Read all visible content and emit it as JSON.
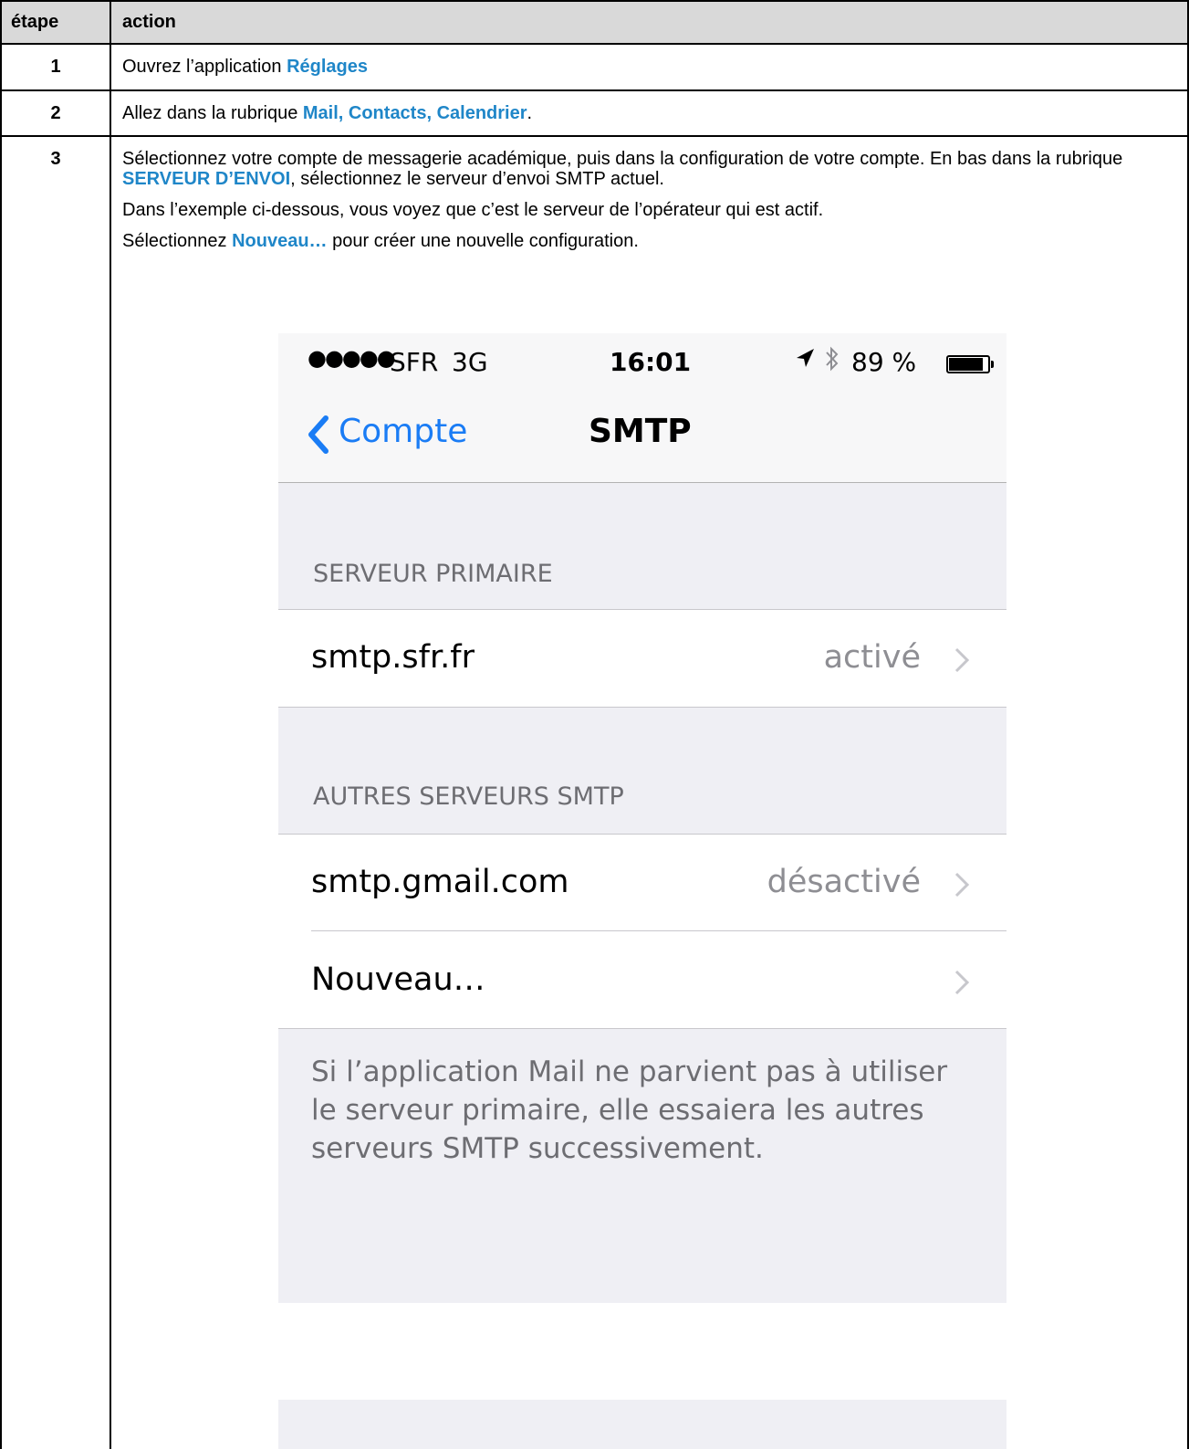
{
  "table": {
    "header": {
      "step": "étape",
      "action": "action"
    },
    "rows": [
      {
        "step": "1",
        "before": "Ouvrez l’application ",
        "kw": "Réglages",
        "after": ""
      },
      {
        "step": "2",
        "before": "Allez dans la rubrique ",
        "kw": "Mail, Contacts, Calendrier",
        "after": "."
      },
      {
        "step": "3",
        "p1_before": "Sélectionnez votre compte de messagerie académique, puis dans la configuration de votre compte. En bas dans la rubrique ",
        "p1_kw": "SERVEUR D’ENVOI",
        "p1_after": ", sélectionnez le serveur d’envoi SMTP actuel.",
        "p2": "Dans l’exemple ci-dessous, vous voyez que c’est le serveur de l’opérateur qui est actif.",
        "p3_before": "Sélectionnez ",
        "p3_kw": "Nouveau…",
        "p3_after": " pour créer une nouvelle configuration."
      }
    ]
  },
  "phone": {
    "status": {
      "signal": "●●●●●",
      "carrier": "SFR",
      "network": "3G",
      "time": "16:01",
      "battery_pct": "89 %",
      "battery_level": 0.89
    },
    "nav": {
      "back_label": "Compte",
      "title": "SMTP"
    },
    "sections": [
      {
        "header": "SERVEUR PRIMAIRE",
        "cells": [
          {
            "label": "smtp.sfr.fr",
            "value": "activé"
          }
        ]
      },
      {
        "header": "AUTRES SERVEURS SMTP",
        "cells": [
          {
            "label": "smtp.gmail.com",
            "value": "désactivé"
          },
          {
            "label": "Nouveau…",
            "value": ""
          }
        ]
      }
    ],
    "footer": "Si l’application Mail ne parvient pas à utiliser le serveur primaire, elle essaiera les autres serveurs SMTP successivement.",
    "icons": {
      "location": "location-arrow-icon",
      "bluetooth": "bluetooth-icon",
      "back": "chevron-left-icon",
      "disclosure": "chevron-right-icon"
    },
    "colors": {
      "accent": "#1a7cf5",
      "keyword": "#1f86c8",
      "group_bg": "#efeff4",
      "secondary_text": "#8e8e93"
    }
  }
}
